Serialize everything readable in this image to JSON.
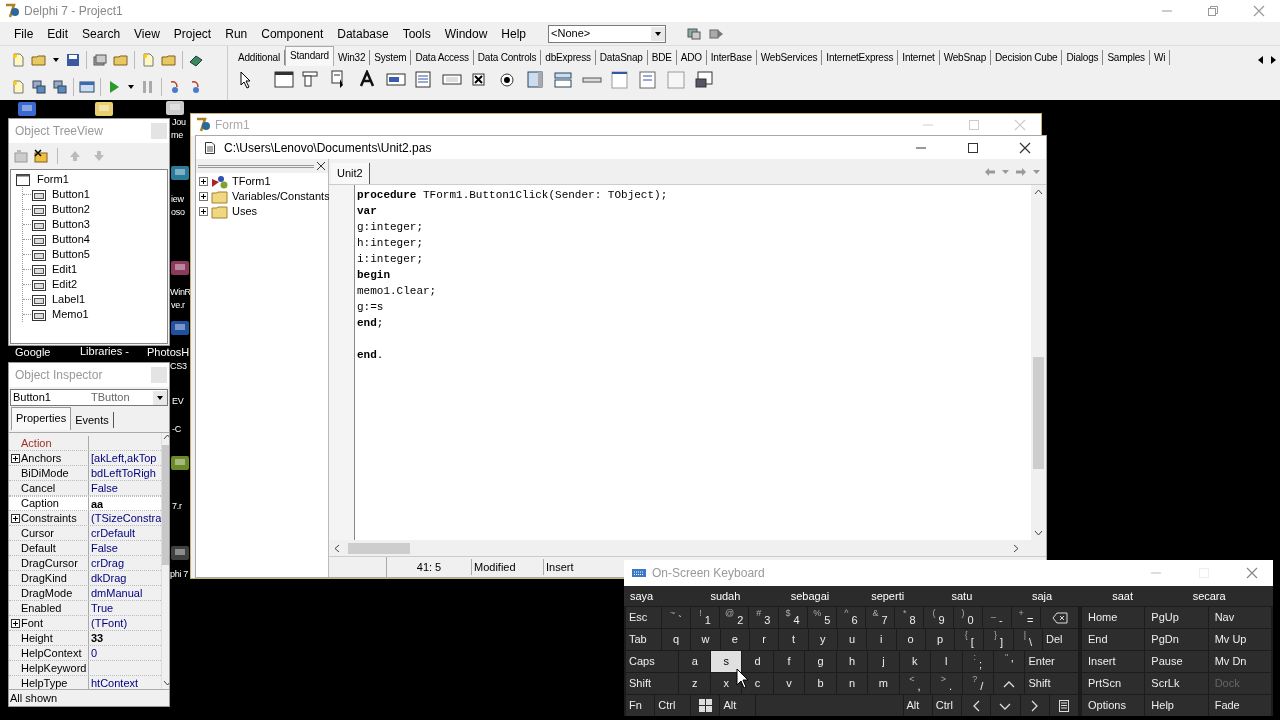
{
  "main_window": {
    "title": "Delphi 7 - Project1",
    "menu": [
      "File",
      "Edit",
      "Search",
      "View",
      "Project",
      "Run",
      "Component",
      "Database",
      "Tools",
      "Window",
      "Help"
    ],
    "config_combo": {
      "value": "<None>"
    },
    "palette_tabs": [
      {
        "label": "Additional",
        "selected": false
      },
      {
        "label": "Standard",
        "selected": true
      },
      {
        "label": "Win32",
        "selected": false
      },
      {
        "label": "System",
        "selected": false
      },
      {
        "label": "Data Access",
        "selected": false
      },
      {
        "label": "Data Controls",
        "selected": false
      },
      {
        "label": "dbExpress",
        "selected": false
      },
      {
        "label": "DataSnap",
        "selected": false
      },
      {
        "label": "BDE",
        "selected": false
      },
      {
        "label": "ADO",
        "selected": false
      },
      {
        "label": "InterBase",
        "selected": false
      },
      {
        "label": "WebServices",
        "selected": false
      },
      {
        "label": "InternetExpress",
        "selected": false
      },
      {
        "label": "Internet",
        "selected": false
      },
      {
        "label": "WebSnap",
        "selected": false
      },
      {
        "label": "Decision Cube",
        "selected": false
      },
      {
        "label": "Dialogs",
        "selected": false
      },
      {
        "label": "Samples",
        "selected": false
      },
      {
        "label": "Wi",
        "selected": false
      }
    ]
  },
  "desktop_labels": [
    "Jou",
    "me",
    "iew",
    "oso",
    "WinR",
    "ve.r",
    "Google",
    "Libraries -",
    "PhotosH",
    "CS3",
    "EV",
    "-C",
    "7.r",
    "phi 7"
  ],
  "object_treeview": {
    "title": "Object TreeView",
    "tree": [
      {
        "label": "Form1",
        "expanded": true,
        "children": [
          {
            "label": "Button1"
          },
          {
            "label": "Button2"
          },
          {
            "label": "Button3"
          },
          {
            "label": "Button4"
          },
          {
            "label": "Button5"
          },
          {
            "label": "Edit1"
          },
          {
            "label": "Edit2"
          },
          {
            "label": "Label1"
          },
          {
            "label": "Memo1"
          }
        ]
      }
    ]
  },
  "object_inspector": {
    "title": "Object Inspector",
    "object": "Button1",
    "object_type": "TButton",
    "tabs": [
      {
        "label": "Properties",
        "selected": true
      },
      {
        "label": "Events",
        "selected": false
      }
    ],
    "properties": [
      {
        "name": "Action",
        "kind": "reference",
        "expandable": false,
        "selected": false
      },
      {
        "name": "Anchors",
        "value": "[akLeft,akTop",
        "kind": "normal",
        "expandable": true,
        "selected": false,
        "modified": false
      },
      {
        "name": "BiDiMode",
        "value": "bdLeftToRigh",
        "kind": "normal",
        "expandable": false,
        "selected": false,
        "modified": false
      },
      {
        "name": "Cancel",
        "value": "False",
        "kind": "normal",
        "expandable": false,
        "selected": false,
        "modified": false
      },
      {
        "name": "Caption",
        "value": "aa",
        "kind": "normal",
        "expandable": false,
        "selected": true,
        "modified": true
      },
      {
        "name": "Constraints",
        "value": "(TSizeConstra",
        "kind": "normal",
        "expandable": true,
        "selected": false,
        "modified": false
      },
      {
        "name": "Cursor",
        "value": "crDefault",
        "kind": "normal",
        "expandable": false,
        "selected": false,
        "modified": false
      },
      {
        "name": "Default",
        "value": "False",
        "kind": "normal",
        "expandable": false,
        "selected": false,
        "modified": false
      },
      {
        "name": "DragCursor",
        "value": "crDrag",
        "kind": "normal",
        "expandable": false,
        "selected": false,
        "modified": false
      },
      {
        "name": "DragKind",
        "value": "dkDrag",
        "kind": "normal",
        "expandable": false,
        "selected": false,
        "modified": false
      },
      {
        "name": "DragMode",
        "value": "dmManual",
        "kind": "normal",
        "expandable": false,
        "selected": false,
        "modified": false
      },
      {
        "name": "Enabled",
        "value": "True",
        "kind": "normal",
        "expandable": false,
        "selected": false,
        "modified": false
      },
      {
        "name": "Font",
        "value": "(TFont)",
        "kind": "normal",
        "expandable": true,
        "selected": false,
        "modified": false
      },
      {
        "name": "Height",
        "value": "33",
        "kind": "normal",
        "expandable": false,
        "selected": false,
        "modified": true
      },
      {
        "name": "HelpContext",
        "value": "0",
        "kind": "normal",
        "expandable": false,
        "selected": false,
        "modified": false
      },
      {
        "name": "HelpKeyword",
        "kind": "normal",
        "expandable": false,
        "selected": false
      },
      {
        "name": "HelpType",
        "value": "htContext",
        "kind": "normal",
        "expandable": false,
        "selected": false,
        "modified": false
      }
    ],
    "status": "All shown"
  },
  "form_window": {
    "title": "Form1"
  },
  "editor_window": {
    "title": "C:\\Users\\Lenovo\\Documents\\Unit2.pas",
    "explorer": [
      {
        "label": "TForm1",
        "kind": "class",
        "expanded": false
      },
      {
        "label": "Variables/Constants",
        "kind": "folder",
        "expanded": false
      },
      {
        "label": "Uses",
        "kind": "folder",
        "expanded": false
      }
    ],
    "tabs": [
      {
        "label": "Unit2",
        "selected": true
      }
    ],
    "code": [
      {
        "kind": "code",
        "text": "**procedure** TForm1.Button1Click(Sender: TObject);"
      },
      {
        "kind": "keyword",
        "text": "var"
      },
      {
        "kind": "code",
        "text": "g:integer;"
      },
      {
        "kind": "code",
        "text": "h:integer;"
      },
      {
        "kind": "code",
        "text": "i:integer;"
      },
      {
        "kind": "keyword",
        "text": "begin"
      },
      {
        "kind": "code",
        "text": "memo1.Clear;"
      },
      {
        "kind": "code",
        "text": "g:=s"
      },
      {
        "kind": "code",
        "text": "**end**;"
      },
      {
        "kind": "blank"
      },
      {
        "kind": "code",
        "text": "**end**."
      }
    ],
    "status": {
      "position": "41:  5",
      "modified": "Modified",
      "mode": "Insert"
    }
  },
  "onscreen_keyboard": {
    "title": "On-Screen Keyboard",
    "suggestions": [
      "saya",
      "sudah",
      "sebagai",
      "seperti",
      "satu",
      "saja",
      "saat",
      "secara"
    ],
    "rows": [
      [
        {
          "label": "Esc",
          "kind": "mod",
          "pressed": false
        },
        {
          "label": "`",
          "shift": "~",
          "kind": "char",
          "pressed": false
        },
        {
          "label": "1",
          "shift": "!",
          "kind": "char",
          "pressed": false
        },
        {
          "label": "2",
          "shift": "@",
          "kind": "char",
          "pressed": false
        },
        {
          "label": "3",
          "shift": "#",
          "kind": "char",
          "pressed": false
        },
        {
          "label": "4",
          "shift": "$",
          "kind": "char",
          "pressed": false
        },
        {
          "label": "5",
          "shift": "%",
          "kind": "char",
          "pressed": false
        },
        {
          "label": "6",
          "shift": "^",
          "kind": "char",
          "pressed": false
        },
        {
          "label": "7",
          "shift": "&",
          "kind": "char",
          "pressed": false
        },
        {
          "label": "8",
          "shift": "*",
          "kind": "char",
          "pressed": false
        },
        {
          "label": "9",
          "shift": "(",
          "kind": "char",
          "pressed": false
        },
        {
          "label": "0",
          "shift": ")",
          "kind": "char",
          "pressed": false
        },
        {
          "label": "-",
          "shift": "_",
          "kind": "char",
          "pressed": false
        },
        {
          "label": "=",
          "shift": "+",
          "kind": "char",
          "pressed": false
        },
        {
          "kind": "backspace",
          "pressed": false
        }
      ],
      [
        {
          "label": "Tab",
          "kind": "mod",
          "pressed": false
        },
        {
          "label": "q",
          "kind": "char",
          "pressed": false
        },
        {
          "label": "w",
          "kind": "char",
          "pressed": false
        },
        {
          "label": "e",
          "kind": "char",
          "pressed": false
        },
        {
          "label": "r",
          "kind": "char",
          "pressed": false
        },
        {
          "label": "t",
          "kind": "char",
          "pressed": false
        },
        {
          "label": "y",
          "kind": "char",
          "pressed": false
        },
        {
          "label": "u",
          "kind": "char",
          "pressed": false
        },
        {
          "label": "i",
          "kind": "char",
          "pressed": false
        },
        {
          "label": "o",
          "kind": "char",
          "pressed": false
        },
        {
          "label": "p",
          "kind": "char",
          "pressed": false
        },
        {
          "label": "[",
          "shift": "{",
          "kind": "char",
          "pressed": false
        },
        {
          "label": "]",
          "shift": "}",
          "kind": "char",
          "pressed": false
        },
        {
          "label": "\\",
          "shift": "|",
          "kind": "char",
          "pressed": false
        },
        {
          "label": "Del",
          "kind": "mod",
          "pressed": false
        }
      ],
      [
        {
          "label": "Caps",
          "kind": "wide",
          "pressed": false
        },
        {
          "label": "a",
          "kind": "char",
          "pressed": false
        },
        {
          "label": "s",
          "kind": "char",
          "pressed": true
        },
        {
          "label": "d",
          "kind": "char",
          "pressed": false
        },
        {
          "label": "f",
          "kind": "char",
          "pressed": false
        },
        {
          "label": "g",
          "kind": "char",
          "pressed": false
        },
        {
          "label": "h",
          "kind": "char",
          "pressed": false
        },
        {
          "label": "j",
          "kind": "char",
          "pressed": false
        },
        {
          "label": "k",
          "kind": "char",
          "pressed": false
        },
        {
          "label": "l",
          "kind": "char",
          "pressed": false
        },
        {
          "label": ";",
          "shift": ":",
          "kind": "char",
          "pressed": false
        },
        {
          "label": "'",
          "shift": "\"",
          "kind": "char",
          "pressed": false
        },
        {
          "label": "Enter",
          "kind": "wide",
          "pressed": false
        }
      ],
      [
        {
          "label": "Shift",
          "kind": "wide",
          "pressed": false
        },
        {
          "label": "z",
          "kind": "char",
          "pressed": false
        },
        {
          "label": "x",
          "kind": "char",
          "pressed": false
        },
        {
          "label": "c",
          "kind": "char",
          "pressed": false
        },
        {
          "label": "v",
          "kind": "char",
          "pressed": false
        },
        {
          "label": "b",
          "kind": "char",
          "pressed": false
        },
        {
          "label": "n",
          "kind": "char",
          "pressed": false
        },
        {
          "label": "m",
          "kind": "char",
          "pressed": false
        },
        {
          "label": ",",
          "shift": "<",
          "kind": "char",
          "pressed": false
        },
        {
          "label": ".",
          "shift": ">",
          "kind": "char",
          "pressed": false
        },
        {
          "label": "/",
          "shift": "?",
          "kind": "char",
          "pressed": false
        },
        {
          "kind": "up",
          "pressed": false
        },
        {
          "label": "Shift",
          "kind": "wide",
          "pressed": false
        }
      ],
      [
        {
          "label": "Fn",
          "kind": "char",
          "pressed": false
        },
        {
          "label": "Ctrl",
          "kind": "mod",
          "pressed": false
        },
        {
          "kind": "windows",
          "pressed": false
        },
        {
          "label": "Alt",
          "kind": "mod",
          "pressed": false
        },
        {
          "kind": "space",
          "pressed": false
        },
        {
          "label": "Alt",
          "kind": "char",
          "pressed": false
        },
        {
          "label": "Ctrl",
          "kind": "char",
          "pressed": false
        },
        {
          "kind": "left",
          "pressed": false
        },
        {
          "kind": "down",
          "pressed": false
        },
        {
          "kind": "right",
          "pressed": false
        },
        {
          "kind": "menu",
          "pressed": false
        }
      ]
    ],
    "side_keys": [
      [
        {
          "label": "Home",
          "disabled": false
        },
        {
          "label": "PgUp",
          "disabled": false
        },
        {
          "label": "Nav",
          "disabled": false
        }
      ],
      [
        {
          "label": "End",
          "disabled": false
        },
        {
          "label": "PgDn",
          "disabled": false
        },
        {
          "label": "Mv Up",
          "disabled": false
        }
      ],
      [
        {
          "label": "Insert",
          "disabled": false
        },
        {
          "label": "Pause",
          "disabled": false
        },
        {
          "label": "Mv Dn",
          "disabled": false
        }
      ],
      [
        {
          "label": "PrtScn",
          "disabled": false
        },
        {
          "label": "ScrLk",
          "disabled": false
        },
        {
          "label": "Dock",
          "disabled": true
        }
      ],
      [
        {
          "label": "Options",
          "disabled": false
        },
        {
          "label": "Help",
          "disabled": false
        },
        {
          "label": "Fade",
          "disabled": false
        }
      ]
    ]
  }
}
